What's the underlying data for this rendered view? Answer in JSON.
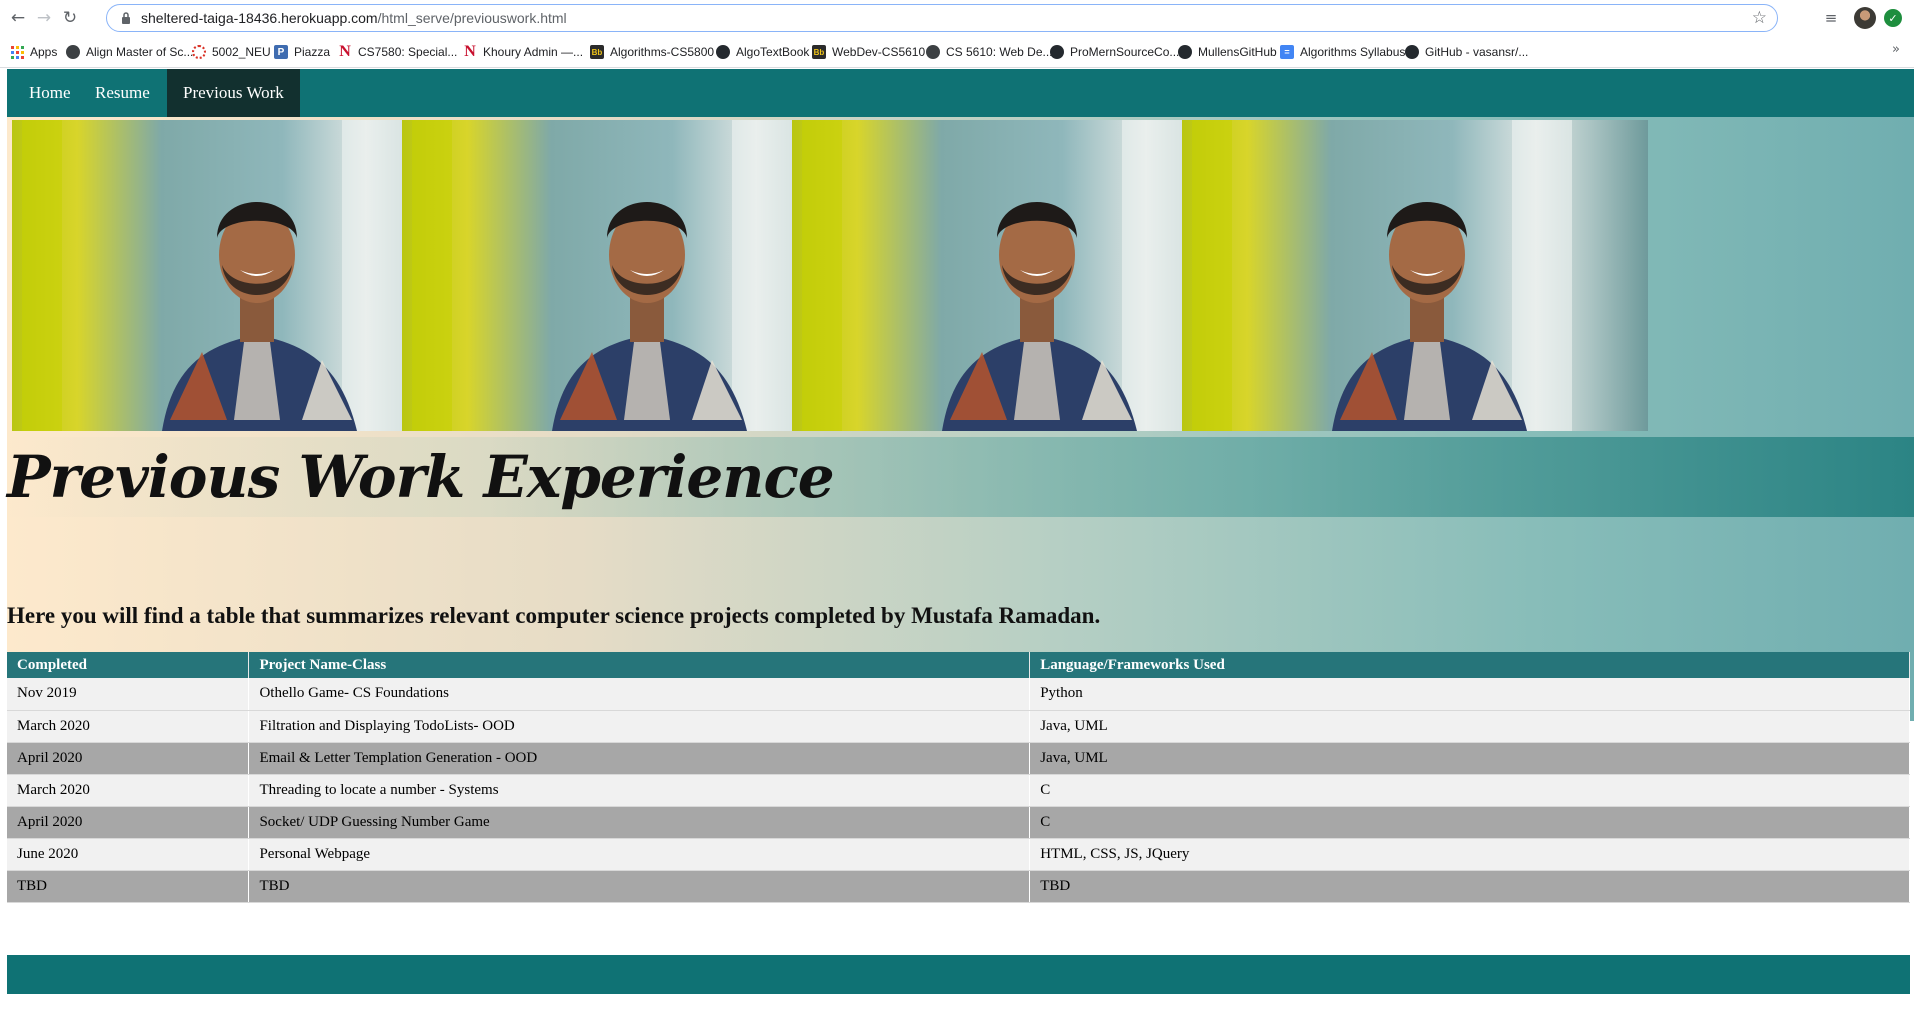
{
  "browser": {
    "url_host": "sheltered-taiga-18436.herokuapp.com",
    "url_path": "/html_serve/previouswork.html",
    "bookmarks": [
      {
        "label": "Apps",
        "icon": "apps-grid-icon"
      },
      {
        "label": "Align Master of Sc...",
        "icon": "globe-icon"
      },
      {
        "label": "5002_NEU",
        "icon": "ring-icon"
      },
      {
        "label": "Piazza",
        "icon": "piazza-icon"
      },
      {
        "label": "CS7580: Special...",
        "icon": "neu-icon"
      },
      {
        "label": "Khoury Admin —...",
        "icon": "neu-icon"
      },
      {
        "label": "Algorithms-CS5800",
        "icon": "blackboard-icon"
      },
      {
        "label": "AlgoTextBook",
        "icon": "github-icon"
      },
      {
        "label": "WebDev-CS5610",
        "icon": "blackboard-icon"
      },
      {
        "label": "CS 5610: Web De...",
        "icon": "globe-icon"
      },
      {
        "label": "ProMernSourceCo...",
        "icon": "github-icon"
      },
      {
        "label": "MullensGitHub",
        "icon": "github-icon"
      },
      {
        "label": "Algorithms Syllabus",
        "icon": "doc-icon"
      },
      {
        "label": "GitHub - vasansr/...",
        "icon": "github-icon"
      }
    ]
  },
  "nav": {
    "items": [
      {
        "label": "Home",
        "active": false
      },
      {
        "label": "Resume",
        "active": false
      },
      {
        "label": "Previous Work",
        "active": true
      }
    ]
  },
  "hero": {
    "photo_count": 4,
    "title": "Previous Work Experience",
    "subtitle": "Here you will find a table that summarizes relevant computer science projects completed by Mustafa Ramadan."
  },
  "table": {
    "headers": [
      "Completed",
      "Project Name-Class",
      "Language/Frameworks Used"
    ],
    "rows": [
      [
        "Nov 2019",
        "Othello Game- CS Foundations",
        "Python"
      ],
      [
        "March 2020",
        "Filtration and Displaying TodoLists- OOD",
        "Java, UML"
      ],
      [
        "April 2020",
        "Email & Letter Templation Generation - OOD",
        "Java, UML"
      ],
      [
        "March 2020",
        "Threading to locate a number - Systems",
        "C"
      ],
      [
        "April 2020",
        "Socket/ UDP Guessing Number Game",
        "C"
      ],
      [
        "June 2020",
        "Personal Webpage",
        "HTML, CSS, JS, JQuery"
      ],
      [
        "TBD",
        "TBD",
        "TBD"
      ]
    ]
  },
  "colors": {
    "nav_bg": "#0f7274",
    "nav_active_bg": "#12302f",
    "table_header_bg": "#26757a",
    "row_light": "#f1f1f1",
    "row_dark": "#a7a7a7"
  }
}
